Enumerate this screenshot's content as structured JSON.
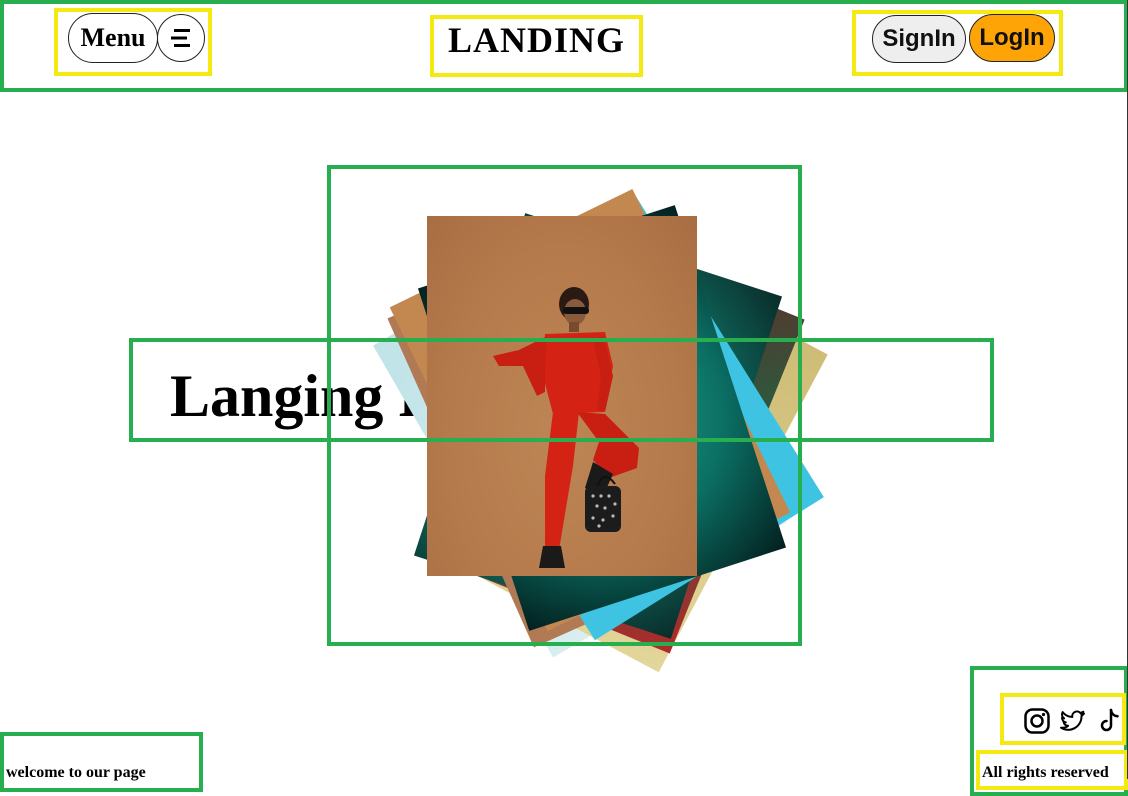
{
  "header": {
    "menu_label": "Menu",
    "menu_icon": "hamburger-icon",
    "title": "LANDING",
    "signin_label": "SignIn",
    "login_label": "LogIn"
  },
  "hero": {
    "headline": "Langing Page For You",
    "main_image": "woman-in-red-jumpsuit-photo"
  },
  "footer": {
    "welcome": "welcome to our page",
    "rights": "All rights reserved",
    "social_icons": [
      "instagram-icon",
      "twitter-icon",
      "tiktok-icon"
    ]
  },
  "colors": {
    "outline_green": "#27ae4f",
    "outline_yellow": "#f4ea12",
    "login_bg": "#ffa406",
    "signin_bg": "#eeeeee",
    "photo_bg": "#b57a4b",
    "jumpsuit_red": "#d42315"
  }
}
